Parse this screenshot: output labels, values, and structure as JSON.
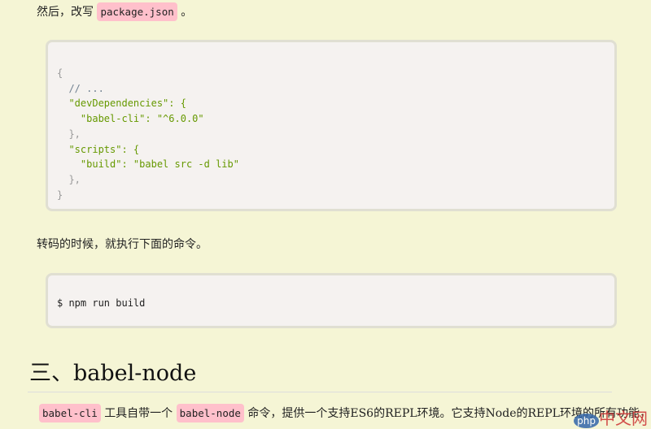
{
  "intro": {
    "text": "然后，改写",
    "code": "package.json",
    "end": "。"
  },
  "code_block_1": {
    "lines": [
      "{",
      "  // ...",
      "  \"devDependencies\": {",
      "    \"babel-cli\": \"^6.0.0\"",
      "  },",
      "  \"scripts\": {",
      "    \"build\": \"babel src -d lib\"",
      "  },",
      "}"
    ]
  },
  "para2": "转码的时候，就执行下面的命令。",
  "code_block_2": "$ npm run build",
  "heading": "三、babel-node",
  "para3": {
    "code1": "babel-cli",
    "text1": "工具自带一个",
    "code2": "babel-node",
    "text2": "命令，提供一个支持ES6的REPL环境。它支持Node的REPL环境的所有功能，"
  },
  "watermark": {
    "logo": "php",
    "text": "中文网"
  }
}
